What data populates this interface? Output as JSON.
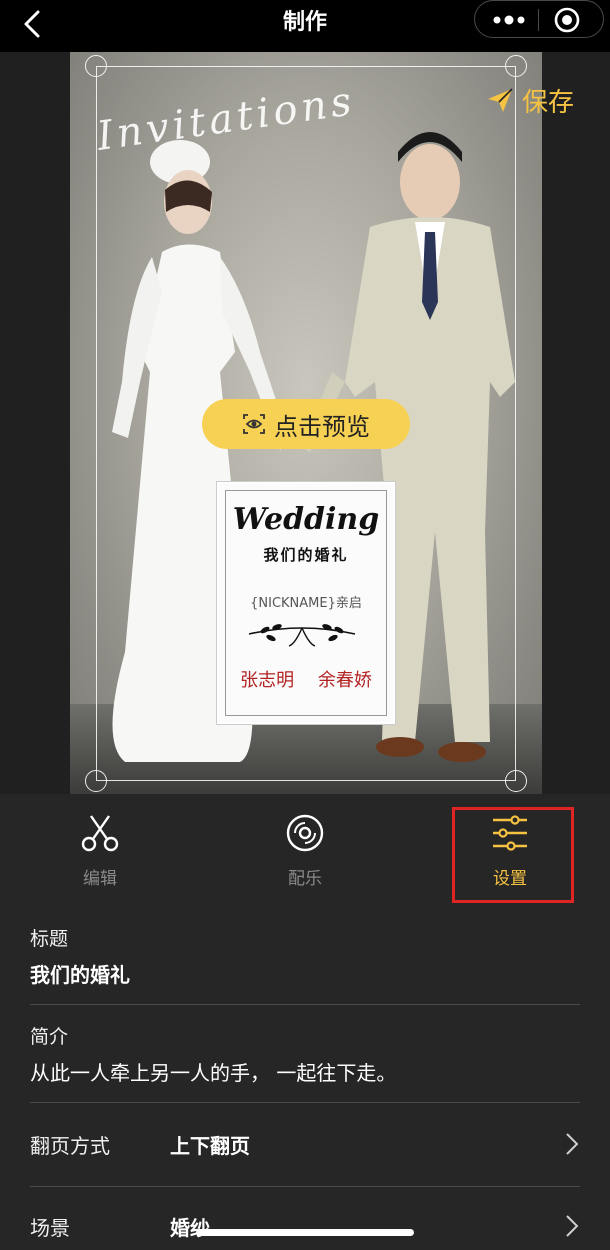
{
  "nav": {
    "title": "制作",
    "back_icon": "chevron-left-icon",
    "more_icon": "more-dots-icon",
    "target_icon": "target-icon"
  },
  "canvas": {
    "decor_text": "Invitations",
    "save_label": "保存",
    "save_icon": "paper-plane-icon",
    "preview_label": "点击预览",
    "preview_icon": "eye-scan-icon",
    "card": {
      "title": "Wedding",
      "subtitle": "我们的婚礼",
      "nickname_line": "{NICKNAME}亲启",
      "names": "张志明 余春娇"
    }
  },
  "toolbar": {
    "items": [
      {
        "label": "编辑",
        "icon": "scissors-icon",
        "active": false
      },
      {
        "label": "配乐",
        "icon": "music-disc-icon",
        "active": false
      },
      {
        "label": "设置",
        "icon": "sliders-icon",
        "active": true
      }
    ]
  },
  "settings": {
    "title": {
      "label": "标题",
      "value": "我们的婚礼"
    },
    "intro": {
      "label": "简介",
      "value": "从此一人牵上另一人的手， 一起往下走。"
    },
    "page_turn": {
      "label": "翻页方式",
      "value": "上下翻页"
    },
    "scene": {
      "label": "场景",
      "value": "婚纱"
    }
  },
  "colors": {
    "accent": "#f5c242",
    "highlight": "#e02424",
    "background": "#262626",
    "names": "#b22222"
  }
}
